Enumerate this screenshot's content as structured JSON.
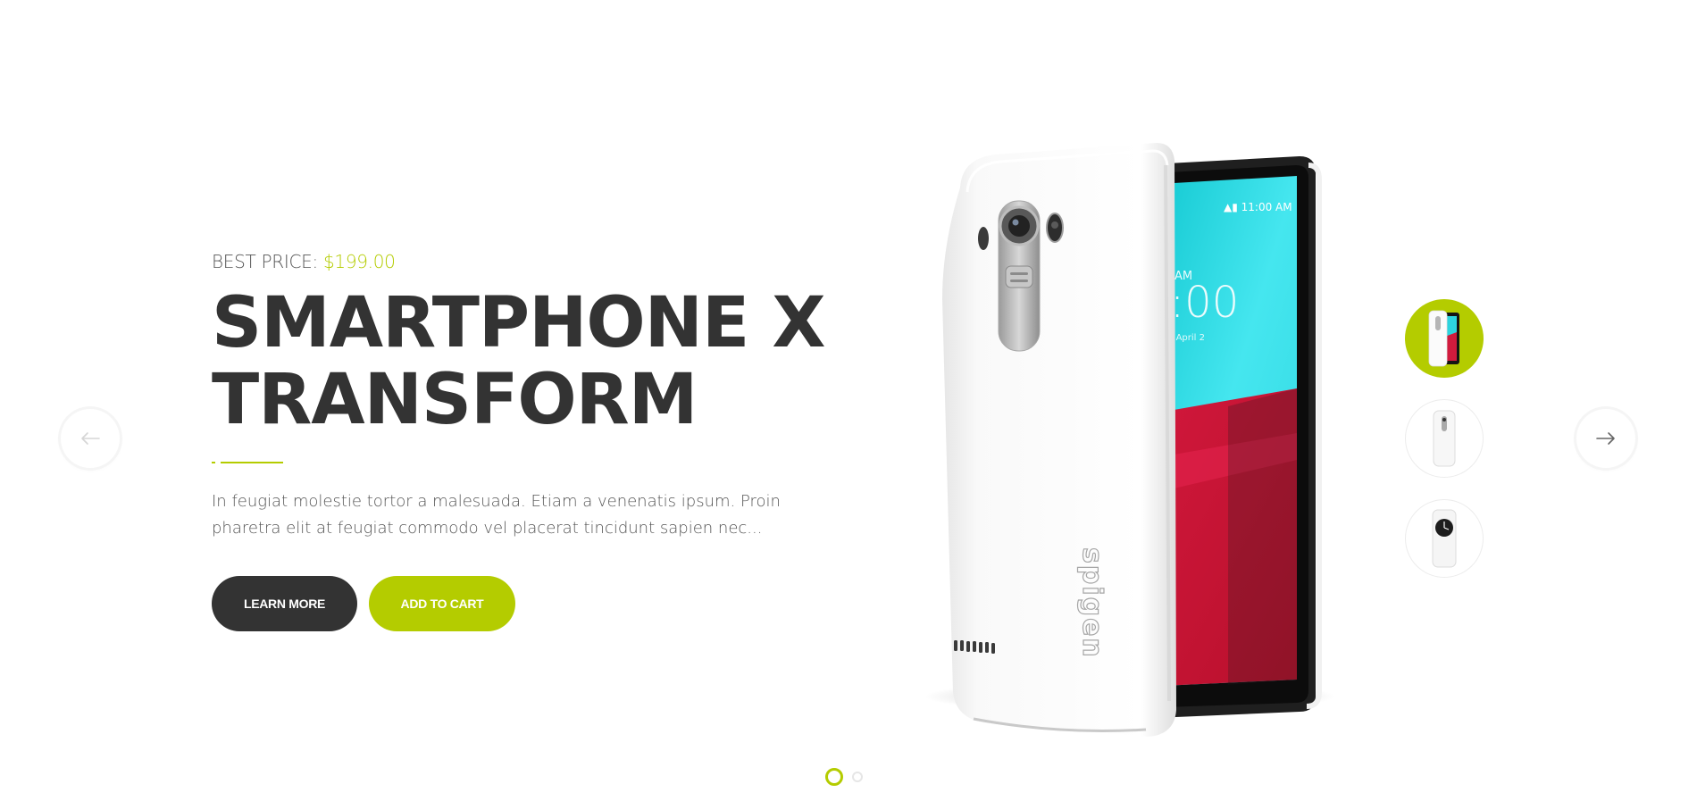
{
  "slide": {
    "price_label": "BEST PRICE:",
    "price_value": "$199.00",
    "title_line1": "SMARTPHONE X",
    "title_line2": "TRANSFORM",
    "description": "In feugiat molestie tortor a malesuada. Etiam a venenatis ipsum. Proin pharetra elit at feugiat commodo vel placerat tincidunt sapien nec...",
    "learn_more_label": "LEARN MORE",
    "add_to_cart_label": "ADD TO CART"
  },
  "product_image": {
    "brand_text": "spigen",
    "status_time": "11:00 AM",
    "clock": "AM\n:00",
    "date_text": "day April 2"
  },
  "navigation": {
    "prev_icon": "arrow-left-icon",
    "next_icon": "arrow-right-icon"
  },
  "thumbnails": [
    {
      "name": "phone-front-back",
      "active": true
    },
    {
      "name": "phone-back",
      "active": false
    },
    {
      "name": "phone-case",
      "active": false
    }
  ],
  "pagination": {
    "total": 2,
    "active_index": 0
  },
  "colors": {
    "accent": "#b4cc00",
    "dark": "#333333",
    "text": "#555555",
    "background": "#ffffff"
  }
}
